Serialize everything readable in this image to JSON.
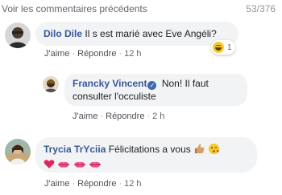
{
  "header": {
    "see_previous": "Voir les commentaires précédents",
    "counter": "53/376"
  },
  "comments": [
    {
      "author": "Dilo Dile",
      "text": "Il s est marié avec Eve Angéli?",
      "actions": {
        "like": "J'aime",
        "reply": "Répondre",
        "time": "12 h"
      },
      "reaction": {
        "emoji": "laughing-emoji",
        "count": "1"
      }
    },
    {
      "author": "Francky Vincent",
      "verified": true,
      "text_line1": "Non! Il faut",
      "text_line2": "consulter l'occuliste",
      "actions": {
        "like": "J'aime",
        "reply": "Répondre",
        "time": "2 h"
      }
    },
    {
      "author": "Trycia TrYciia",
      "text": "Félicitations a vous",
      "emojis": [
        "thumbs-up-emoji",
        "kissing-heart-emoji",
        "heart-emoji",
        "kiss-mark-emoji",
        "kiss-mark-emoji",
        "kiss-mark-emoji"
      ],
      "actions": {
        "like": "J'aime",
        "reply": "Répondre",
        "time": "12 h"
      }
    }
  ],
  "colors": {
    "author": "#385898",
    "bubble": "#f2f3f5",
    "meta": "#616770"
  }
}
